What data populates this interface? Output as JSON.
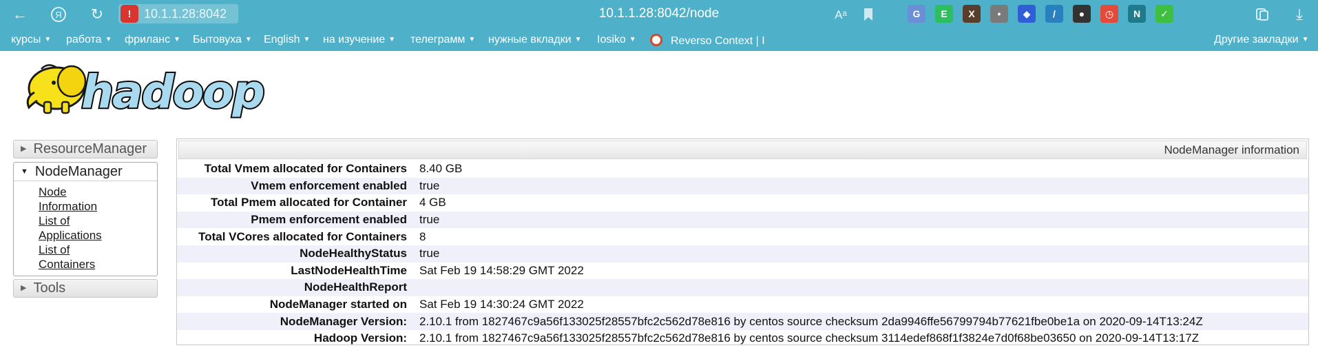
{
  "browser": {
    "address_chip": "10.1.1.28:8042",
    "page_url": "10.1.1.28:8042/node",
    "extensions": [
      {
        "name": "translate-icon",
        "color": "#6b8fd6",
        "glyph": "G"
      },
      {
        "name": "evernote-icon",
        "color": "#2dbe60",
        "glyph": "E"
      },
      {
        "name": "tampermonkey-icon",
        "color": "#5a3e2b",
        "glyph": "X"
      },
      {
        "name": "ghost-icon",
        "color": "#7a7a7a",
        "glyph": "•"
      },
      {
        "name": "cube-icon",
        "color": "#2f5fd6",
        "glyph": "◆"
      },
      {
        "name": "pen-icon",
        "color": "#2a7fbf",
        "glyph": "/"
      },
      {
        "name": "balls-icon",
        "color": "#333333",
        "glyph": "●"
      },
      {
        "name": "clock-icon",
        "color": "#e34a3a",
        "glyph": "◷"
      },
      {
        "name": "notion-icon",
        "color": "#1f7a8c",
        "glyph": "N"
      },
      {
        "name": "shield-check-icon",
        "color": "#3fbf3f",
        "glyph": "✓"
      }
    ]
  },
  "bookmarks": [
    {
      "label": "курсы",
      "folder": true
    },
    {
      "label": "работа",
      "folder": true
    },
    {
      "label": "фриланс",
      "folder": true
    },
    {
      "label": "Бытовуха",
      "folder": true
    },
    {
      "label": "English",
      "folder": true
    },
    {
      "label": "на изучение",
      "folder": true
    },
    {
      "label": "телеграмм",
      "folder": true
    },
    {
      "label": "нужные вкладки",
      "folder": true
    },
    {
      "label": "Iosiko",
      "folder": true
    },
    {
      "label": "Reverso Context | I",
      "folder": false
    },
    {
      "label": "Другие закладки",
      "folder": true
    }
  ],
  "logo_text": "hadoop",
  "sidebar": {
    "resource_manager": "ResourceManager",
    "node_manager": "NodeManager",
    "links": [
      "Node Information",
      "List of Applications",
      "List of Containers"
    ],
    "tools": "Tools"
  },
  "info": {
    "title": "NodeManager information",
    "rows": [
      {
        "key": "Total Vmem allocated for Containers",
        "value": "8.40 GB"
      },
      {
        "key": "Vmem enforcement enabled",
        "value": "true"
      },
      {
        "key": "Total Pmem allocated for Container",
        "value": "4 GB"
      },
      {
        "key": "Pmem enforcement enabled",
        "value": "true"
      },
      {
        "key": "Total VCores allocated for Containers",
        "value": "8"
      },
      {
        "key": "NodeHealthyStatus",
        "value": "true"
      },
      {
        "key": "LastNodeHealthTime",
        "value": "Sat Feb 19 14:58:29 GMT 2022"
      },
      {
        "key": "NodeHealthReport",
        "value": ""
      },
      {
        "key": "NodeManager started on",
        "value": "Sat Feb 19 14:30:24 GMT 2022"
      },
      {
        "key": "NodeManager Version:",
        "value": "2.10.1 from 1827467c9a56f133025f28557bfc2c562d78e816 by centos source checksum 2da9946ffe56799794b77621fbe0be1a on 2020-09-14T13:24Z"
      },
      {
        "key": "Hadoop Version:",
        "value": "2.10.1 from 1827467c9a56f133025f28557bfc2c562d78e816 by centos source checksum 3114edef868f1f3824e7d0f68be03650 on 2020-09-14T13:17Z"
      }
    ]
  }
}
